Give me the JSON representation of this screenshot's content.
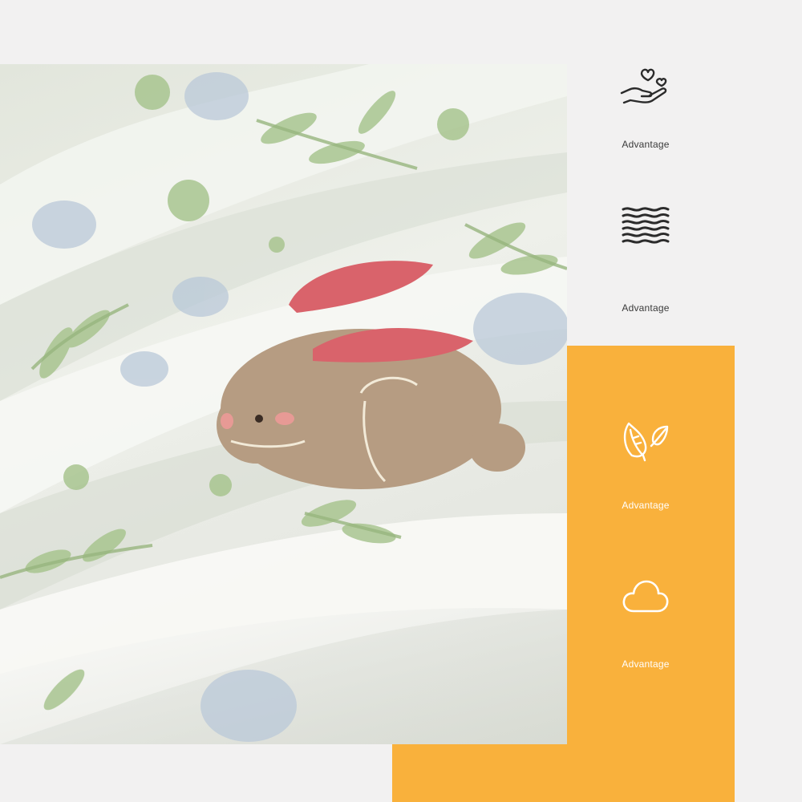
{
  "features": [
    {
      "icon": "hand-heart-icon",
      "label": "Advantage"
    },
    {
      "icon": "waves-icon",
      "label": "Advantage"
    },
    {
      "icon": "leaves-icon",
      "label": "Advantage"
    },
    {
      "icon": "cloud-icon",
      "label": "Advantage"
    }
  ],
  "colors": {
    "background": "#f2f1f1",
    "accent_orange": "#f9b13c",
    "icon_dark": "#2b2b2b",
    "icon_light": "#ffffff"
  }
}
